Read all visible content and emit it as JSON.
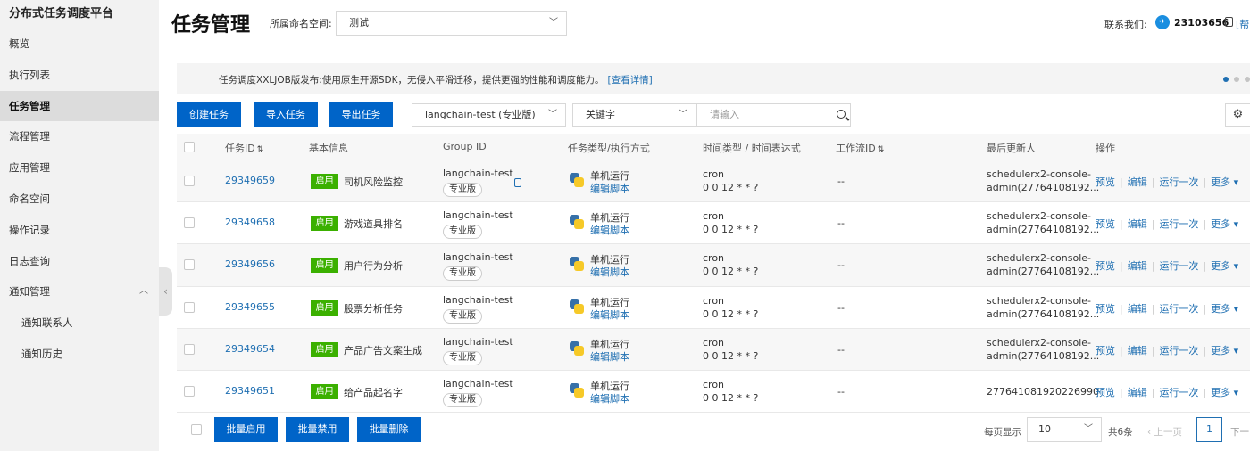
{
  "sidebar": {
    "brand": "分布式任务调度平台",
    "items": [
      {
        "label": "概览"
      },
      {
        "label": "执行列表"
      },
      {
        "label": "任务管理"
      },
      {
        "label": "流程管理"
      },
      {
        "label": "应用管理"
      },
      {
        "label": "命名空间"
      },
      {
        "label": "操作记录"
      },
      {
        "label": "日志查询"
      },
      {
        "label": "通知管理"
      },
      {
        "label": "通知联系人"
      },
      {
        "label": "通知历史"
      }
    ]
  },
  "header": {
    "title": "任务管理",
    "namespace_label": "所属命名空间:",
    "namespace_value": "测试",
    "contact_label": "联系我们:",
    "contact_number": "23103656",
    "help": "[帮"
  },
  "banner": {
    "text": "任务调度XXLJOB版发布:使用原生开源SDK，无侵入平滑迁移，提供更强的性能和调度能力。",
    "link": "[查看详情]"
  },
  "toolbar": {
    "create": "创建任务",
    "import": "导入任务",
    "export": "导出任务",
    "app_select": "langchain-test (专业版)",
    "filter_type": "关键字",
    "search_placeholder": "请输入"
  },
  "table": {
    "headers": {
      "id": "任务ID",
      "info": "基本信息",
      "group": "Group ID",
      "type": "任务类型/执行方式",
      "time": "时间类型 / 时间表达式",
      "workflow": "工作流ID",
      "updater": "最后更新人",
      "ops": "操作"
    },
    "rows": [
      {
        "id": "29349659",
        "status": "启用",
        "name": "司机风险监控",
        "group": "langchain-test",
        "edition": "专业版",
        "exec": "单机运行",
        "edit": "编辑脚本",
        "time_type": "cron",
        "expr": "0 0 12 * * ?",
        "workflow": "--",
        "updater1": "schedulerx2-console-",
        "updater2": "admin(27764108192..."
      },
      {
        "id": "29349658",
        "status": "启用",
        "name": "游戏道具排名",
        "group": "langchain-test",
        "edition": "专业版",
        "exec": "单机运行",
        "edit": "编辑脚本",
        "time_type": "cron",
        "expr": "0 0 12 * * ?",
        "workflow": "--",
        "updater1": "schedulerx2-console-",
        "updater2": "admin(27764108192..."
      },
      {
        "id": "29349656",
        "status": "启用",
        "name": "用户行为分析",
        "group": "langchain-test",
        "edition": "专业版",
        "exec": "单机运行",
        "edit": "编辑脚本",
        "time_type": "cron",
        "expr": "0 0 12 * * ?",
        "workflow": "--",
        "updater1": "schedulerx2-console-",
        "updater2": "admin(27764108192..."
      },
      {
        "id": "29349655",
        "status": "启用",
        "name": "股票分析任务",
        "group": "langchain-test",
        "edition": "专业版",
        "exec": "单机运行",
        "edit": "编辑脚本",
        "time_type": "cron",
        "expr": "0 0 12 * * ?",
        "workflow": "--",
        "updater1": "schedulerx2-console-",
        "updater2": "admin(27764108192..."
      },
      {
        "id": "29349654",
        "status": "启用",
        "name": "产品广告文案生成",
        "group": "langchain-test",
        "edition": "专业版",
        "exec": "单机运行",
        "edit": "编辑脚本",
        "time_type": "cron",
        "expr": "0 0 12 * * ?",
        "workflow": "--",
        "updater1": "schedulerx2-console-",
        "updater2": "admin(27764108192..."
      },
      {
        "id": "29349651",
        "status": "启用",
        "name": "给产品起名字",
        "group": "langchain-test",
        "edition": "专业版",
        "exec": "单机运行",
        "edit": "编辑脚本",
        "time_type": "cron",
        "expr": "0 0 12 * * ?",
        "workflow": "--",
        "updater1": "277641081920226990",
        "updater2": ""
      }
    ],
    "ops": {
      "preview": "预览",
      "edit": "编辑",
      "run": "运行一次",
      "more": "更多"
    }
  },
  "footer": {
    "bulk_enable": "批量启用",
    "bulk_disable": "批量禁用",
    "bulk_delete": "批量删除",
    "page_size_label": "每页显示",
    "page_size": "10",
    "total": "共6条",
    "prev": "上一页",
    "page": "1",
    "next": "下一"
  },
  "colors": {
    "primary": "#0064c8",
    "link": "#1f6fb2",
    "enabled": "#3bb000"
  }
}
